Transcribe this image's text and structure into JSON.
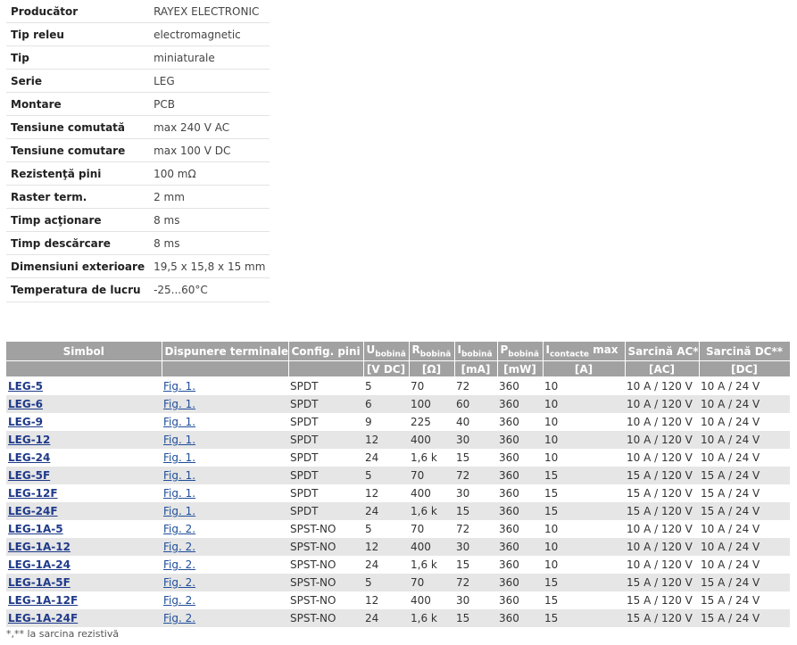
{
  "specs": [
    {
      "label": "Producător",
      "value": "RAYEX ELECTRONIC"
    },
    {
      "label": "Tip releu",
      "value": "electromagnetic"
    },
    {
      "label": "Tip",
      "value": "miniaturale"
    },
    {
      "label": "Serie",
      "value": "LEG"
    },
    {
      "label": "Montare",
      "value": "PCB"
    },
    {
      "label": "Tensiune comutată",
      "value": "max 240 V AC"
    },
    {
      "label": "Tensiune comutare",
      "value": "max 100 V DC"
    },
    {
      "label": "Rezistenţă pini",
      "value": "100 mΩ"
    },
    {
      "label": "Raster term.",
      "value": "2 mm"
    },
    {
      "label": "Timp acţionare",
      "value": "8 ms"
    },
    {
      "label": "Timp descărcare",
      "value": "8 ms"
    },
    {
      "label": "Dimensiuni exterioare",
      "value": "19,5 x 15,8 x 15 mm"
    },
    {
      "label": "Temperatura de lucru",
      "value": "-25...60°C"
    }
  ],
  "table": {
    "headers": {
      "simbol": "Simbol",
      "dispunere": "Dispunere terminale",
      "config": "Config. pini",
      "u": "U",
      "u_sub": "bobină",
      "r": "R",
      "r_sub": "bobină",
      "i": "I",
      "i_sub": "bobină",
      "p": "P",
      "p_sub": "bobină",
      "ic": "I",
      "ic_sub": "contacte",
      "ic_suffix": " max",
      "ac": "Sarcină AC*",
      "dc": "Sarcină DC**"
    },
    "units": {
      "u": "[V DC]",
      "r": "[Ω]",
      "i": "[mA]",
      "p": "[mW]",
      "ic": "[A]",
      "ac": "[AC]",
      "dc": "[DC]"
    },
    "rows": [
      {
        "sym": "LEG-5",
        "fig": "Fig. 1.",
        "cfg": "SPDT",
        "u": "5",
        "r": "70",
        "i": "72",
        "p": "360",
        "ic": "10",
        "ac": "10 A / 120 V",
        "dc": "10 A / 24 V"
      },
      {
        "sym": "LEG-6",
        "fig": "Fig. 1.",
        "cfg": "SPDT",
        "u": "6",
        "r": "100",
        "i": "60",
        "p": "360",
        "ic": "10",
        "ac": "10 A / 120 V",
        "dc": "10 A / 24 V"
      },
      {
        "sym": "LEG-9",
        "fig": "Fig. 1.",
        "cfg": "SPDT",
        "u": "9",
        "r": "225",
        "i": "40",
        "p": "360",
        "ic": "10",
        "ac": "10 A / 120 V",
        "dc": "10 A / 24 V"
      },
      {
        "sym": "LEG-12",
        "fig": "Fig. 1.",
        "cfg": "SPDT",
        "u": "12",
        "r": "400",
        "i": "30",
        "p": "360",
        "ic": "10",
        "ac": "10 A / 120 V",
        "dc": "10 A / 24 V"
      },
      {
        "sym": "LEG-24",
        "fig": "Fig. 1.",
        "cfg": "SPDT",
        "u": "24",
        "r": "1,6 k",
        "i": "15",
        "p": "360",
        "ic": "10",
        "ac": "10 A / 120 V",
        "dc": "10 A / 24 V"
      },
      {
        "sym": "LEG-5F",
        "fig": "Fig. 1.",
        "cfg": "SPDT",
        "u": "5",
        "r": "70",
        "i": "72",
        "p": "360",
        "ic": "15",
        "ac": "15 A / 120 V",
        "dc": "15 A / 24 V"
      },
      {
        "sym": "LEG-12F",
        "fig": "Fig. 1.",
        "cfg": "SPDT",
        "u": "12",
        "r": "400",
        "i": "30",
        "p": "360",
        "ic": "15",
        "ac": "15 A / 120 V",
        "dc": "15 A / 24 V"
      },
      {
        "sym": "LEG-24F",
        "fig": "Fig. 1.",
        "cfg": "SPDT",
        "u": "24",
        "r": "1,6 k",
        "i": "15",
        "p": "360",
        "ic": "15",
        "ac": "15 A / 120 V",
        "dc": "15 A / 24 V"
      },
      {
        "sym": "LEG-1A-5",
        "fig": "Fig. 2.",
        "cfg": "SPST-NO",
        "u": "5",
        "r": "70",
        "i": "72",
        "p": "360",
        "ic": "10",
        "ac": "10 A / 120 V",
        "dc": "10 A / 24 V"
      },
      {
        "sym": "LEG-1A-12",
        "fig": "Fig. 2.",
        "cfg": "SPST-NO",
        "u": "12",
        "r": "400",
        "i": "30",
        "p": "360",
        "ic": "10",
        "ac": "10 A / 120 V",
        "dc": "10 A / 24 V"
      },
      {
        "sym": "LEG-1A-24",
        "fig": "Fig. 2.",
        "cfg": "SPST-NO",
        "u": "24",
        "r": "1,6 k",
        "i": "15",
        "p": "360",
        "ic": "10",
        "ac": "10 A / 120 V",
        "dc": "10 A / 24 V"
      },
      {
        "sym": "LEG-1A-5F",
        "fig": "Fig. 2.",
        "cfg": "SPST-NO",
        "u": "5",
        "r": "70",
        "i": "72",
        "p": "360",
        "ic": "15",
        "ac": "15 A / 120 V",
        "dc": "15 A / 24 V"
      },
      {
        "sym": "LEG-1A-12F",
        "fig": "Fig. 2.",
        "cfg": "SPST-NO",
        "u": "12",
        "r": "400",
        "i": "30",
        "p": "360",
        "ic": "15",
        "ac": "15 A / 120 V",
        "dc": "15 A / 24 V"
      },
      {
        "sym": "LEG-1A-24F",
        "fig": "Fig. 2.",
        "cfg": "SPST-NO",
        "u": "24",
        "r": "1,6 k",
        "i": "15",
        "p": "360",
        "ic": "15",
        "ac": "15 A / 120 V",
        "dc": "15 A / 24 V"
      }
    ]
  },
  "footnote": "*,** la sarcina rezistivă",
  "colors": {
    "header_bg": "#a1a1a1",
    "row_alt_bg": "#e6e6e6",
    "link": "#1f3a8a"
  }
}
